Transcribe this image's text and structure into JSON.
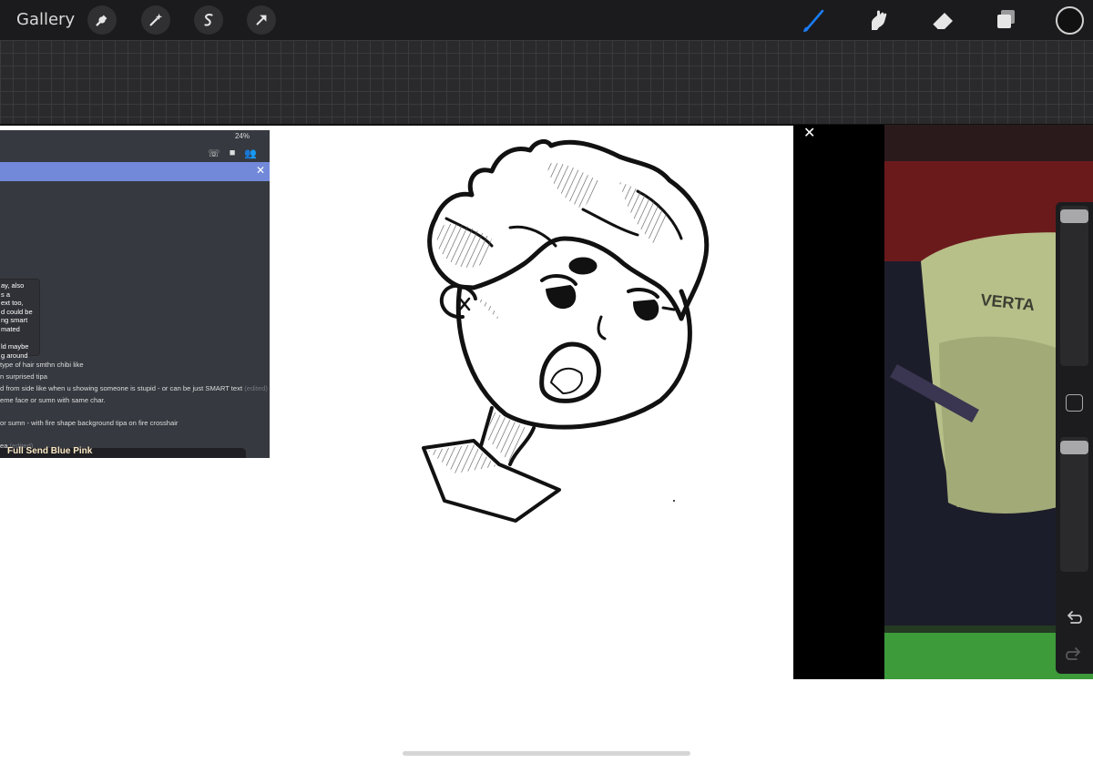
{
  "toolbar": {
    "gallery_label": "Gallery",
    "left_tools": [
      "wrench-icon",
      "magic-wand-icon",
      "selection-s-icon",
      "transform-arrow-icon"
    ],
    "right_tools": [
      "brush-icon",
      "smudge-icon",
      "eraser-icon",
      "layers-icon"
    ],
    "active_tool": "brush-icon",
    "accent_color": "#1a7cf5",
    "current_color": "#111111"
  },
  "reference_chat": {
    "status": "24%",
    "header_icons": [
      "phone-icon",
      "video-call-icon",
      "members-icon"
    ],
    "banner_close": "✕",
    "bubble_lines": [
      "ay, also",
      "s a",
      "ext too,",
      "d could be",
      "ng smart",
      "mated",
      "",
      "ld maybe",
      "g around"
    ],
    "message_lines": [
      "type of hair smthn chibi like",
      "n surprised tipa",
      "d from side like when u showing someone is stupid - or can be just SMART text",
      "eme face or sumn with same char.",
      "",
      "or sumn - with fire shape background tipa on fire crosshair",
      "",
      "ea"
    ],
    "message_suffixes": [
      "(edited)",
      "(edited)"
    ],
    "bottom_text": "Full Send Blue Pink"
  },
  "reference_video": {
    "close_label": "✕",
    "chair_text": "VERTA"
  },
  "sidebar": {
    "size_slider": 1.0,
    "opacity_slider": 1.0
  }
}
